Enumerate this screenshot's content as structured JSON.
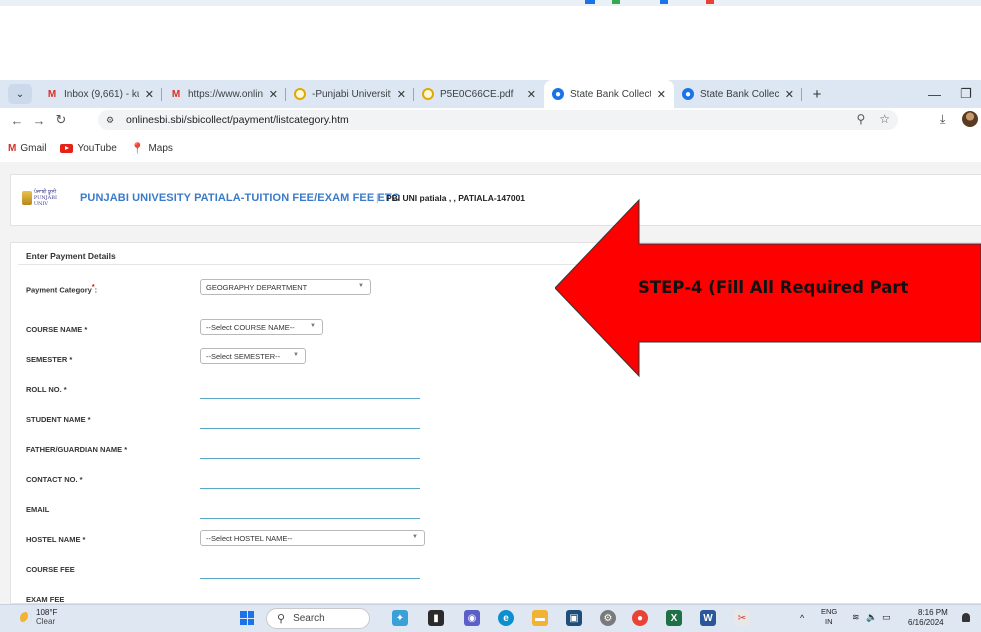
{
  "browser": {
    "tabs": [
      {
        "title": "Inbox (9,661) - kumar",
        "icon": "gmail-icon"
      },
      {
        "title": "https://www.onlinesb",
        "icon": "gmail-icon"
      },
      {
        "title": "-Punjabi University, P",
        "icon": "q-icon"
      },
      {
        "title": "P5E0C66CE.pdf",
        "icon": "q-icon"
      },
      {
        "title": "State Bank Collect",
        "icon": "sbi-icon",
        "active": true
      },
      {
        "title": "State Bank Collect",
        "icon": "sbi-icon"
      }
    ],
    "url": "onlinesbi.sbi/sbicollect/payment/listcategory.htm",
    "bookmarks": [
      "Gmail",
      "YouTube",
      "Maps"
    ]
  },
  "header": {
    "logo_text_1": "ਪੰਜਾਬੀ ਯੂਨੀ",
    "logo_text_2": "PUNJABI UNIV",
    "title": "PUNJABI UNIVESITY PATIALA-TUITION FEE/EXAM FEE ETC",
    "separator": "|",
    "address": "PBI UNI patiala , , PATIALA-147001"
  },
  "form": {
    "section_title": "Enter Payment Details",
    "payment_category": {
      "label": "Payment Category",
      "required_mark": "*",
      "colon": ":",
      "value": "GEOGRAPHY DEPARTMENT"
    },
    "course_name": {
      "label": "COURSE NAME *",
      "value": "--Select COURSE NAME--"
    },
    "semester": {
      "label": "SEMESTER *",
      "value": "--Select SEMESTER--"
    },
    "roll_no": {
      "label": "ROLL NO. *"
    },
    "student_name": {
      "label": "STUDENT NAME *"
    },
    "father_name": {
      "label": "FATHER/GUARDIAN NAME *"
    },
    "contact_no": {
      "label": "CONTACT NO. *"
    },
    "email": {
      "label": "EMAIL"
    },
    "hostel_name": {
      "label": "HOSTEL NAME *",
      "value": "--Select HOSTEL NAME--"
    },
    "course_fee": {
      "label": "COURSE FEE"
    },
    "exam_fee": {
      "label": "EXAM FEE"
    }
  },
  "annotation": {
    "text": "STEP-4 (Fill All Required Part",
    "arrow_color": "#ff0000"
  },
  "taskbar": {
    "temp": "108°F",
    "condition": "Clear",
    "search_label": "Search",
    "lang_1": "ENG",
    "lang_2": "IN",
    "time": "8:16 PM",
    "date": "6/16/2024"
  }
}
